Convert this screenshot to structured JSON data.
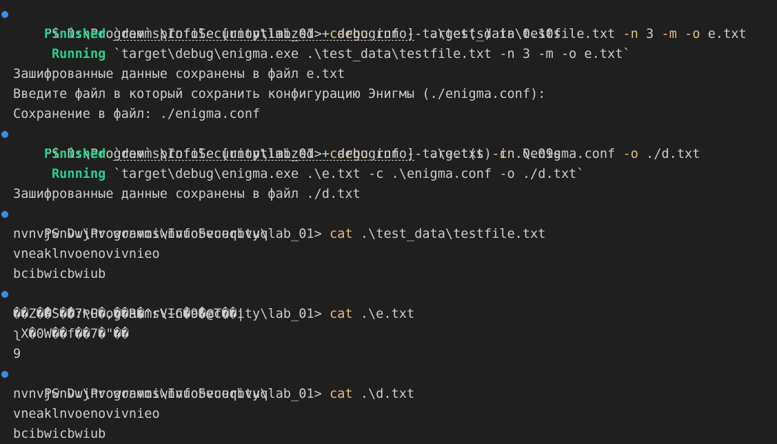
{
  "colors": {
    "background": "#1f1f1f",
    "text": "#cccccc",
    "command": "#e5c07b",
    "status_green": "#23d18b",
    "prompt_dot": "#3b8eea"
  },
  "icons": {
    "prompt_marker": "circle-dot-icon"
  },
  "prompt": "PS D:\\Programms\\InfoSecurity\\lab_01>",
  "block1": {
    "cmd": "cargo",
    "run": "run --",
    "path": ".\\test_data\\testfile.txt",
    "flag_n": "-n",
    "n_val": "3",
    "flag_m": "-m",
    "flag_o": "-o",
    "o_val": "e.txt",
    "finished_label": "Finished",
    "finished_text1": "`dev` profile [unoptimized + debuginfo]",
    "finished_text2": "target(s) in 0.10s",
    "running_label": "Running",
    "running_text": "`target\\debug\\enigma.exe .\\test_data\\testfile.txt -n 3 -m -o e.txt`",
    "out1": "Зашифрованные данные сохранены в файл e.txt",
    "out2": "Введите файл в который сохранить конфигурацию Энигмы (./enigma.conf):",
    "out3": "Сохранение в файл: ./enigma.conf"
  },
  "block2": {
    "cmd": "cargo",
    "run": "run --",
    "path": ".\\e.txt",
    "flag_c": "-c",
    "c_val": ".\\enigma.conf",
    "flag_o": "-o",
    "o_val": "./d.txt",
    "finished_label": "Finished",
    "finished_text1": "`dev` profile [unoptimized + debuginfo]",
    "finished_text2": "target(s) in 0.09s",
    "running_label": "Running",
    "running_text": "`target\\debug\\enigma.exe .\\e.txt -c .\\enigma.conf -o ./d.txt`",
    "out1": "Зашифрованные данные сохранены в файл ./d.txt"
  },
  "block3": {
    "cmd": "cat",
    "arg": ".\\test_data\\testfile.txt",
    "lines": [
      "nvnvjwnvwjnvowonvoiwnvuobvueqbvuq",
      "vneaklnvoenovivnieo",
      "bcibwicbwiub"
    ]
  },
  "block4": {
    "cmd": "cat",
    "arg": ".\\e.txt",
    "lines": [
      "��Z��`��7ⱣG�,��R�^rV~C�9�@T��|",
      "ʅX�0W��f��7�\"��",
      "9"
    ]
  },
  "block5": {
    "cmd": "cat",
    "arg": ".\\d.txt",
    "lines": [
      "nvnvjwnvwjnvowonvoiwnvuobvueqbvuq",
      "vneaklnvoenovivnieo",
      "bcibwicbwiub"
    ]
  }
}
